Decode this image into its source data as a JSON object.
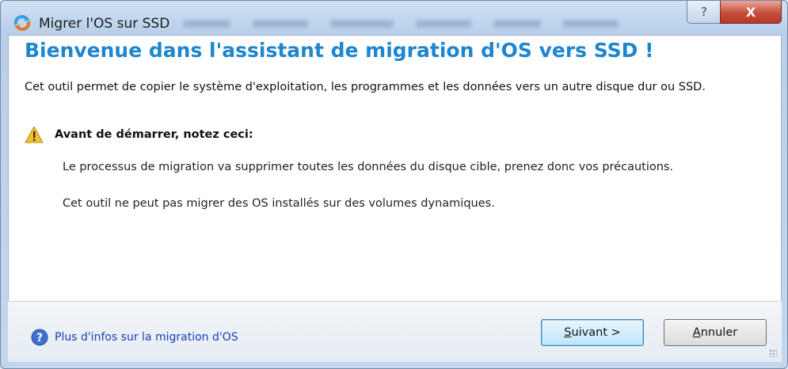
{
  "window": {
    "title": "Migrer l'OS sur SSD",
    "help_glyph": "?",
    "close_glyph": "X"
  },
  "content": {
    "heading": "Bienvenue dans l'assistant de migration d'OS vers SSD !",
    "intro": "Cet outil permet de copier le système d'exploitation, les programmes et les données vers un autre disque dur ou SSD.",
    "warning_title": "Avant de démarrer, notez ceci:",
    "note1": "Le processus de migration va supprimer toutes les données du disque cible, prenez donc vos précautions.",
    "note2": "Cet outil ne peut pas migrer des OS installés sur des volumes dynamiques."
  },
  "footer": {
    "info_link": "Plus d'infos sur la migration d'OS",
    "next_accel": "S",
    "next_rest": "uivant >",
    "cancel_accel": "A",
    "cancel_rest": "nnuler"
  },
  "colors": {
    "heading": "#1d86cf",
    "link": "#1a3dbf",
    "close_button": "#c84d3a"
  },
  "icons": {
    "app": "migrate-os-icon",
    "warning": "warning-icon",
    "info": "question-circle-icon"
  }
}
